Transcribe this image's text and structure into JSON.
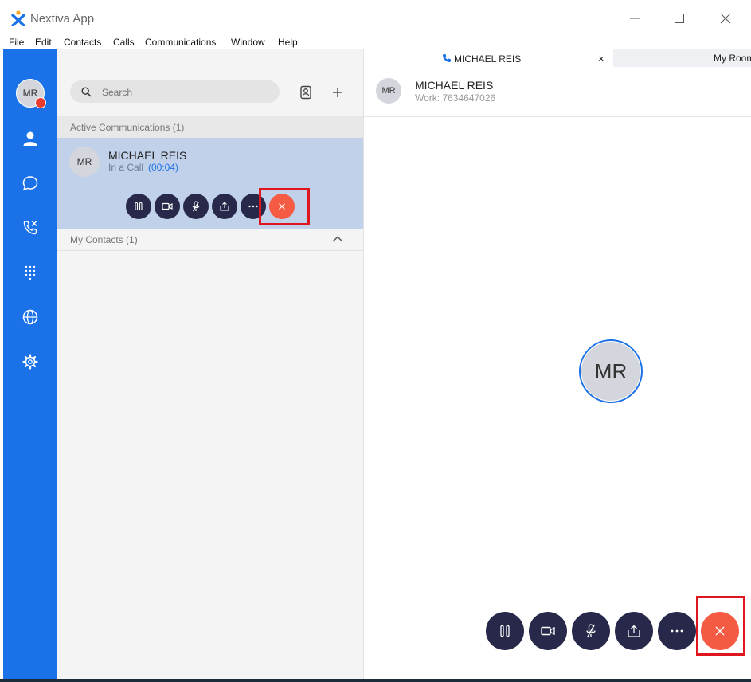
{
  "app": {
    "title": "Nextiva App"
  },
  "menu": [
    "File",
    "Edit",
    "Contacts",
    "Calls",
    "Communications",
    "Window",
    "Help"
  ],
  "sidebar": {
    "user_initials": "MR"
  },
  "search": {
    "placeholder": "Search"
  },
  "active_section": {
    "label": "Active Communications (1)"
  },
  "active_call": {
    "initials": "MR",
    "name": "MICHAEL REIS",
    "status": "In a Call",
    "duration": "(00:04)"
  },
  "contacts_section": {
    "label": "My Contacts (1)"
  },
  "tabs": [
    {
      "label": "MICHAEL REIS",
      "close": "×"
    },
    {
      "label": "My Room"
    }
  ],
  "call_header": {
    "initials": "MR",
    "name": "MICHAEL REIS",
    "detail": "Work: 7634647026"
  },
  "call_center": {
    "initials": "MR"
  },
  "colors": {
    "accent": "#1b72e8",
    "end_call": "#f55a43",
    "control": "#28294a",
    "highlight": "#e0161f"
  }
}
